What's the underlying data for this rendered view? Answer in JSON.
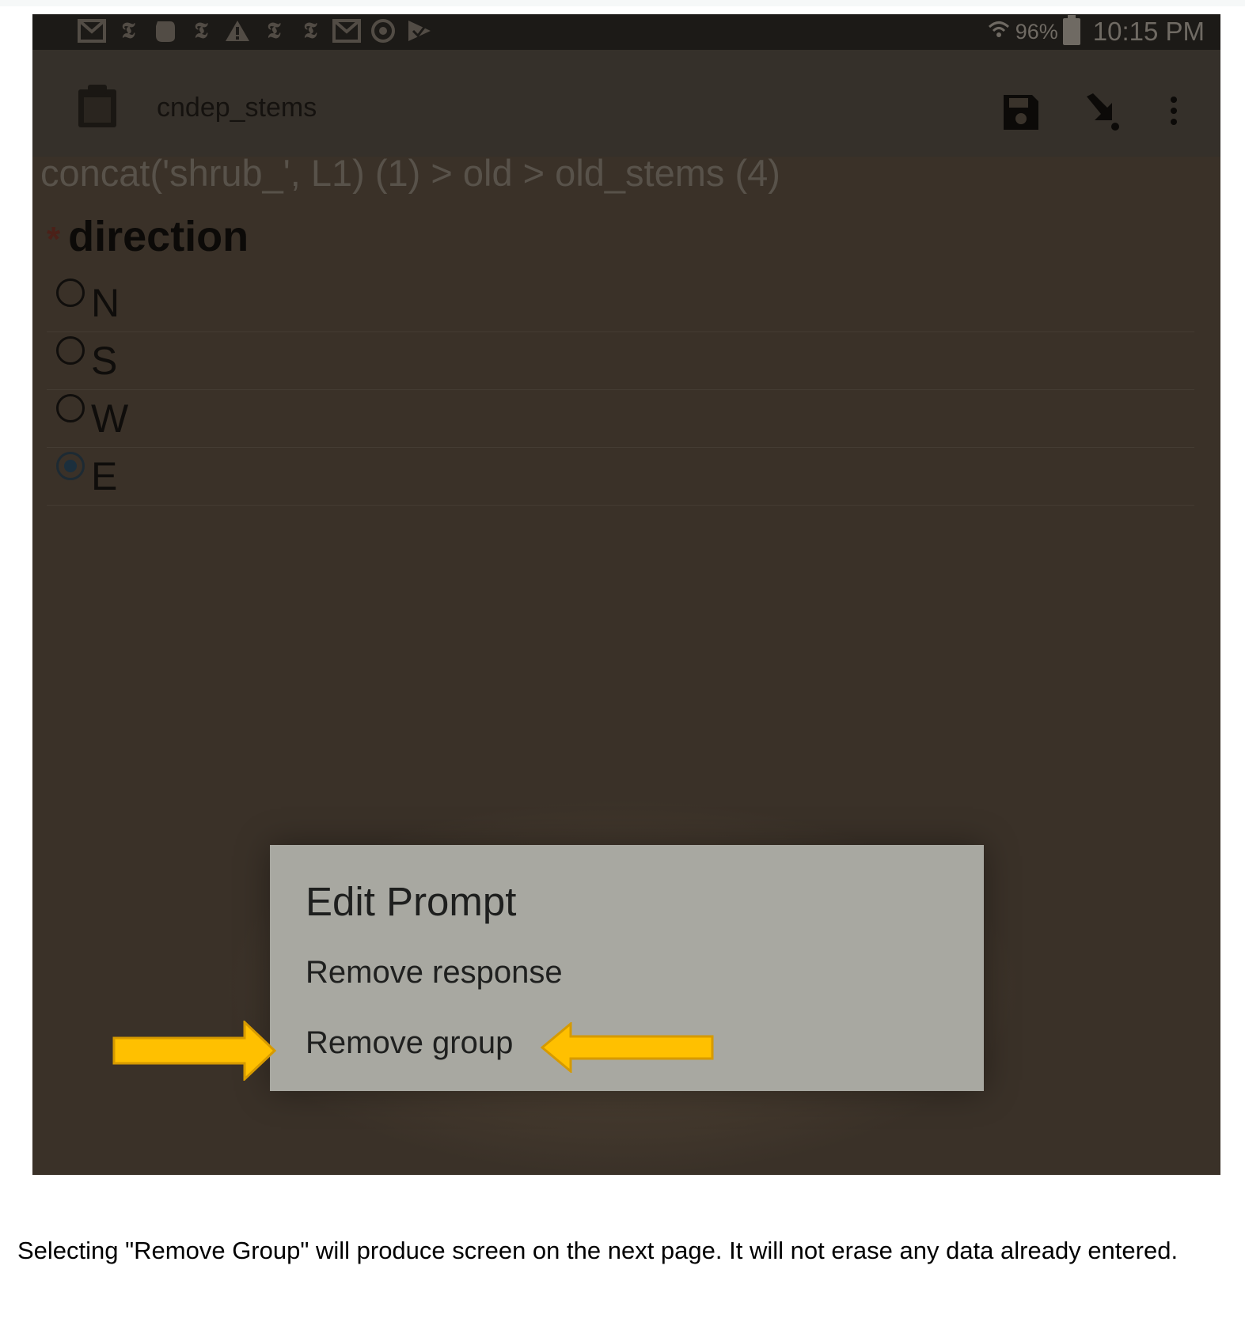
{
  "status_bar": {
    "notification_icons": [
      "mail-icon",
      "nyt-icon",
      "evernote-icon",
      "nyt-icon",
      "warning-icon",
      "nyt-icon",
      "nyt-icon",
      "mail-icon",
      "sync-icon",
      "check-icon"
    ],
    "battery_percent": "96%",
    "time": "10:15 PM"
  },
  "app_bar": {
    "title": "cndep_stems",
    "icons": [
      "clipboard-icon",
      "save-icon",
      "navigate-icon",
      "more-vert-icon"
    ]
  },
  "breadcrumb": "concat('shrub_', L1) (1) > old > old_stems (4)",
  "question": {
    "required_marker": "*",
    "label": "direction",
    "options": [
      {
        "label": "N",
        "selected": false
      },
      {
        "label": "S",
        "selected": false
      },
      {
        "label": "W",
        "selected": false
      },
      {
        "label": "E",
        "selected": true
      }
    ]
  },
  "dialog": {
    "title": "Edit Prompt",
    "items": [
      "Remove response",
      "Remove group"
    ]
  },
  "annotation_arrows": {
    "color": "#ffc000",
    "stroke": "#d69a00",
    "target": "Remove group"
  },
  "caption": "Selecting \"Remove Group\" will produce screen on the next page.  It will not erase any data already entered."
}
